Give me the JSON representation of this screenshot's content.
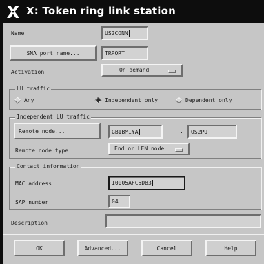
{
  "window": {
    "title": "X: Token ring link station",
    "icon": "x-window-icon"
  },
  "name": {
    "label": "Name",
    "value": "US2CONN"
  },
  "sna_port": {
    "button_label": "SNA port name...",
    "value": "TRPORT"
  },
  "activation": {
    "label": "Activation",
    "selected": "On demand"
  },
  "lu_traffic": {
    "title": "LU traffic",
    "options": [
      "Any",
      "Independent only",
      "Dependent only"
    ],
    "selected": "Independent only"
  },
  "independent_lu": {
    "title": "Independent LU traffic",
    "remote_node_button": "Remote node...",
    "network_name": "GBIBMIYA",
    "separator": ".",
    "node_name": "OS2PU",
    "remote_node_type_label": "Remote node type",
    "remote_node_type_selected": "End or LEN node"
  },
  "contact": {
    "title": "Contact information",
    "mac_label": "MAC address",
    "mac_value": "10005AFC5D83",
    "sap_label": "SAP number",
    "sap_value": "04"
  },
  "description": {
    "label": "Description",
    "value": ""
  },
  "buttons": {
    "ok": "OK",
    "advanced": "Advanced...",
    "cancel": "Cancel",
    "help": "Help"
  }
}
